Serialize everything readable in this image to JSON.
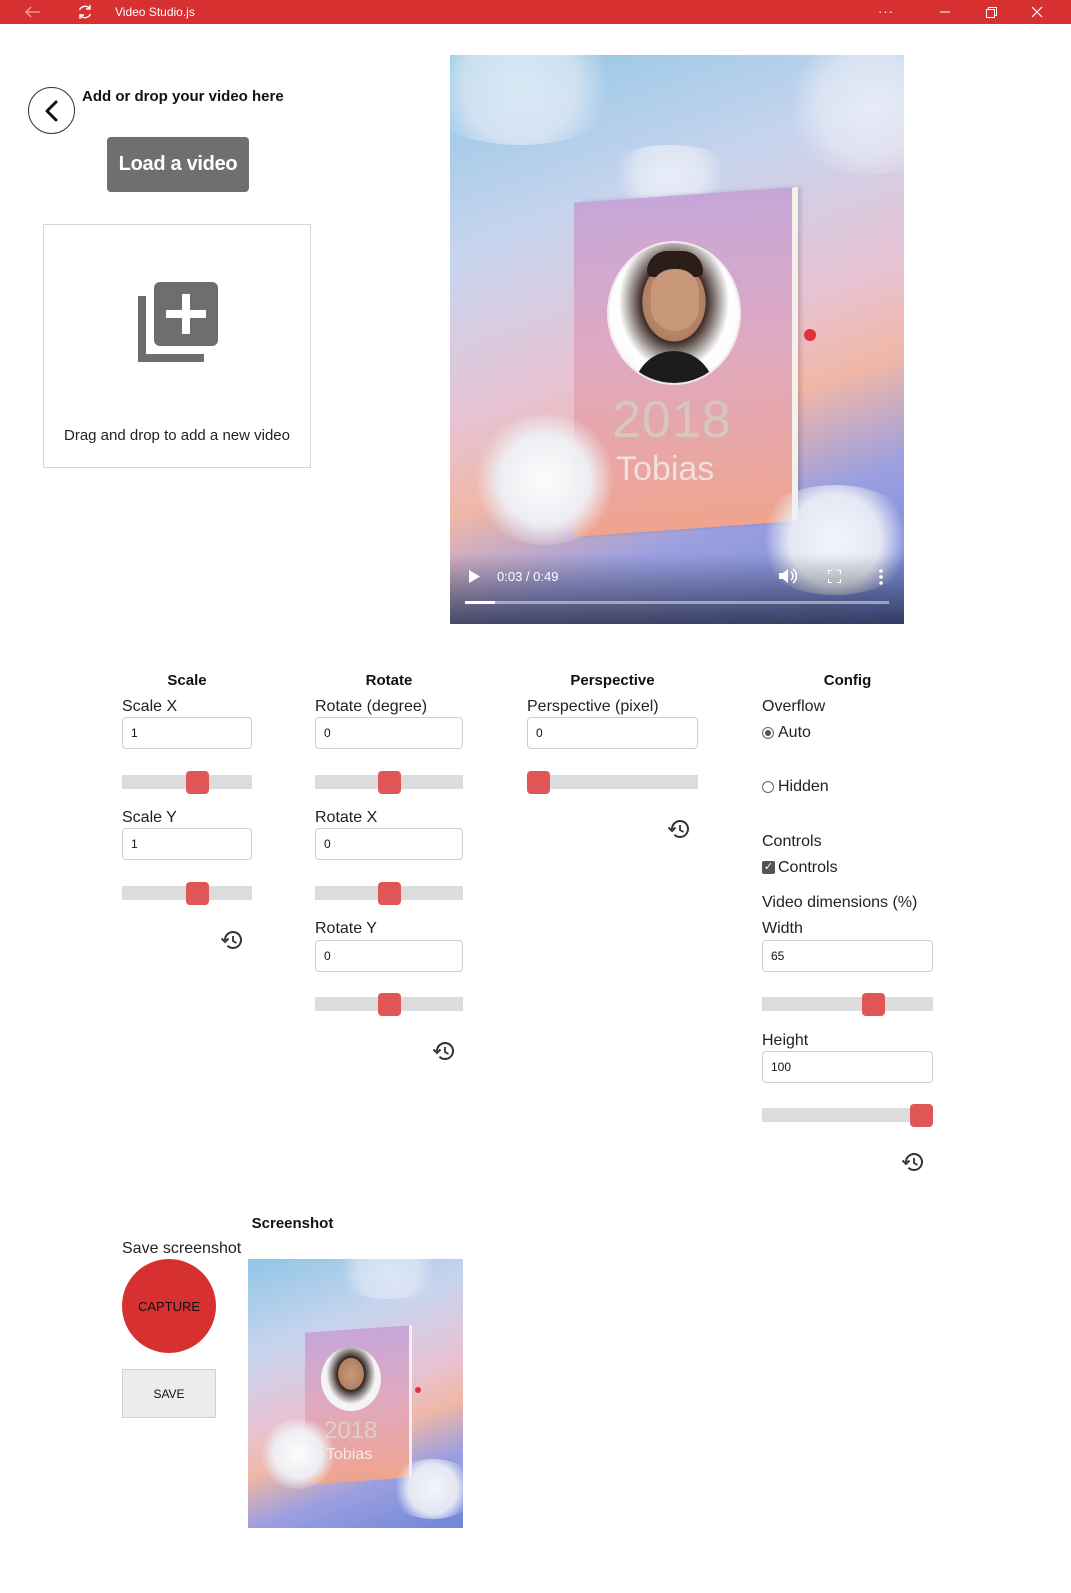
{
  "titlebar": {
    "back_icon": "arrow-left-icon",
    "refresh_icon": "refresh-icon",
    "title": "Video Studio.js",
    "more": "···",
    "colors": {
      "bar": "#d63031",
      "text": "#ffffff"
    }
  },
  "left": {
    "heading": "Add or drop your video here",
    "load_label": "Load a video",
    "drop_text": "Drag and drop to add a new video",
    "drop_icon": "library-add-icon"
  },
  "video": {
    "book_year": "2018",
    "book_name": "Tobias",
    "time": "0:03 / 0:49",
    "progress": 0.07
  },
  "scale": {
    "title": "Scale",
    "x_label": "Scale X",
    "x_value": "1",
    "x_slider": 0.58,
    "y_label": "Scale Y",
    "y_value": "1",
    "y_slider": 0.58
  },
  "rotate": {
    "title": "Rotate",
    "deg_label": "Rotate (degree)",
    "deg_value": "0",
    "deg_slider": 0.5,
    "x_label": "Rotate X",
    "x_value": "0",
    "x_slider": 0.5,
    "y_label": "Rotate Y",
    "y_value": "0",
    "y_slider": 0.5
  },
  "perspective": {
    "title": "Perspective",
    "label": "Perspective (pixel)",
    "value": "0",
    "slider": 0.0
  },
  "config": {
    "title": "Config",
    "overflow_label": "Overflow",
    "overflow_auto": "Auto",
    "overflow_hidden": "Hidden",
    "overflow_selected": "Auto",
    "controls_label": "Controls",
    "controls_checkbox": "Controls",
    "controls_checked": true,
    "dims_label": "Video dimensions (%)",
    "width_label": "Width",
    "width_value": "65",
    "width_slider": 0.65,
    "height_label": "Height",
    "height_value": "100",
    "height_slider": 1.0
  },
  "screenshot": {
    "title": "Screenshot",
    "save_label_text": "Save screenshot",
    "capture_label": "CAPTURE",
    "save_label": "SAVE",
    "book_year": "2018",
    "book_name": "Tobias"
  },
  "accent": {
    "slider_thumb": "#e05656",
    "capture": "#d63031"
  }
}
